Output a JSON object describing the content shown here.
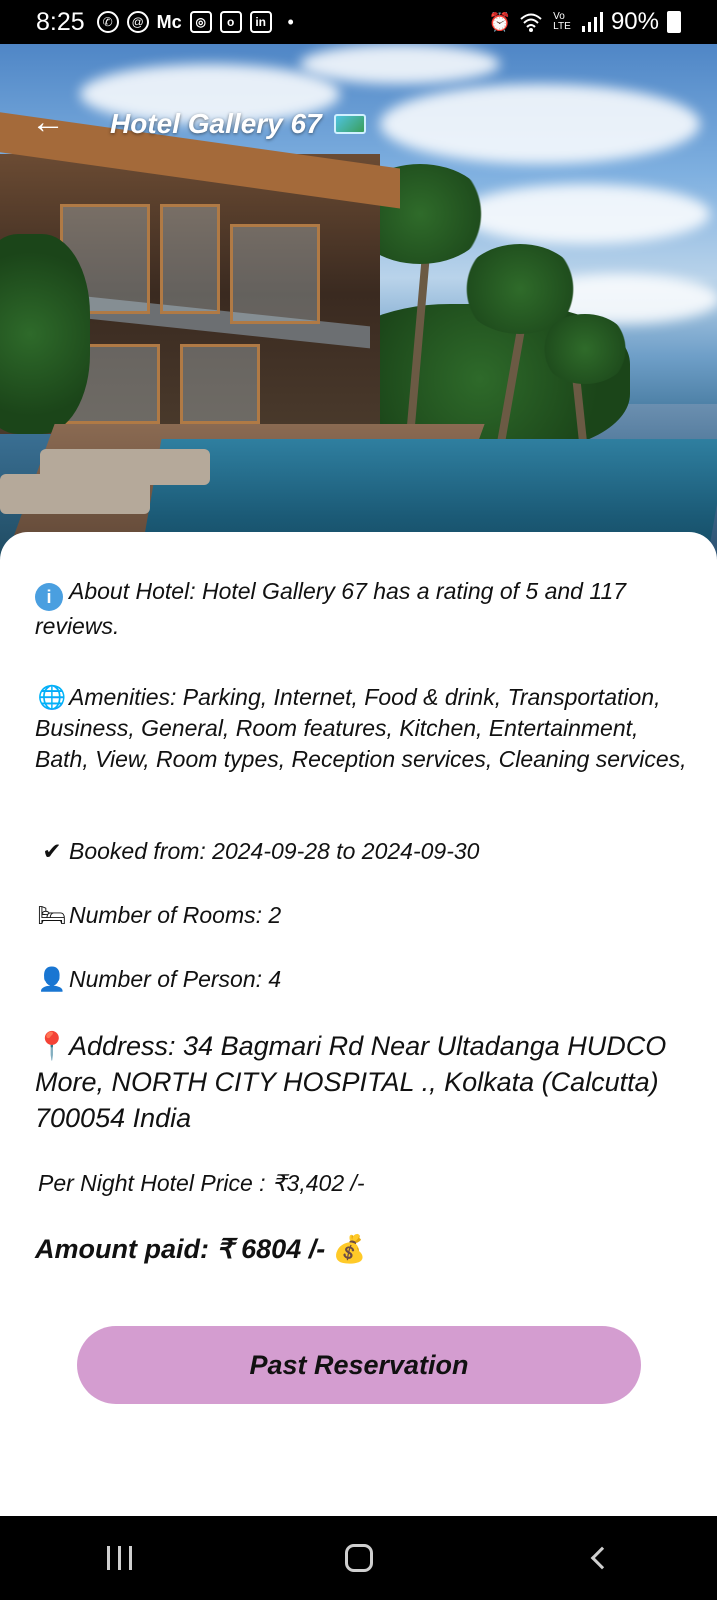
{
  "status_bar": {
    "time": "8:25",
    "left_icons": [
      "whatsapp-icon",
      "threads-icon",
      "mc-icon",
      "instagram-icon",
      "outlook-icon",
      "linkedin-icon",
      "dot-icon"
    ],
    "mc_text": "Mc",
    "in_text": "in",
    "right_icons": [
      "alarm-icon",
      "wifi-icon",
      "volte-icon",
      "signal-icon"
    ],
    "battery_percent": "90%"
  },
  "header": {
    "title": "Hotel Gallery 67",
    "back_icon": "arrow-left-icon"
  },
  "details": {
    "about": "About Hotel: Hotel Gallery 67 has a rating of 5 and 117 reviews.",
    "amenities": "Amenities: Parking, Internet, Food & drink, Transportation, Business, General, Room features, Kitchen, Entertainment, Bath, View, Room types, Reception services, Cleaning services,",
    "booked": "Booked from: 2024-09-28 to 2024-09-30",
    "rooms": "Number of Rooms: 2",
    "persons": "Number of Person: 4",
    "address": "Address: 34 Bagmari Rd Near Ultadanga HUDCO More, NORTH CITY HOSPITAL ., Kolkata (Calcutta) 700054 India",
    "price": "Per Night Hotel Price : ₹3,402 /-",
    "amount": "Amount paid: ₹ 6804 /-"
  },
  "icons": {
    "info": "i",
    "globe": "🌐",
    "check": "✔",
    "bed": "🛏",
    "person": "👤",
    "pin": "📍",
    "money": "💰"
  },
  "button": {
    "label": "Past Reservation"
  },
  "colors": {
    "button_bg": "#d49dd0",
    "card_bg": "#ffffff",
    "bars": "#000000"
  }
}
